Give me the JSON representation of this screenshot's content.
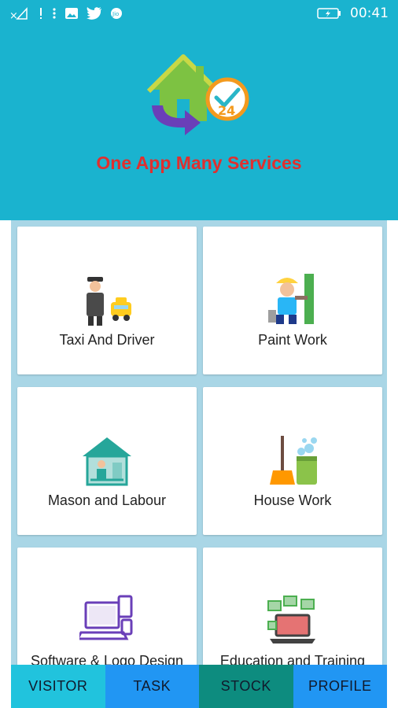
{
  "status_bar": {
    "time": "00:41",
    "icons": [
      "signal-off-icon",
      "notification-icon",
      "more-vert-icon",
      "image-icon",
      "twitter-icon",
      "jio-icon",
      "battery-charging-icon"
    ]
  },
  "header": {
    "tagline": "One App Many Services",
    "logo_icon": "home-24-logo"
  },
  "services": [
    {
      "label": "Taxi And Driver",
      "icon": "taxi-driver-icon"
    },
    {
      "label": "Paint Work",
      "icon": "painter-icon"
    },
    {
      "label": "Mason and Labour",
      "icon": "mason-house-icon"
    },
    {
      "label": "House Work",
      "icon": "cleaning-broom-icon"
    },
    {
      "label": "Software & Logo Design",
      "icon": "computer-devices-icon"
    },
    {
      "label": "Education and Training",
      "icon": "laptop-books-icon"
    }
  ],
  "bottom_nav": [
    {
      "label": "VISITOR",
      "color": "#21c3dd"
    },
    {
      "label": "TASK",
      "color": "#2196f3"
    },
    {
      "label": "STOCK",
      "color": "#0d8c7f"
    },
    {
      "label": "PROFILE",
      "color": "#2196f3"
    }
  ],
  "colors": {
    "primary": "#1ab3cf",
    "tagline": "#e02f2f",
    "grid_bg": "#a9d6e6"
  }
}
